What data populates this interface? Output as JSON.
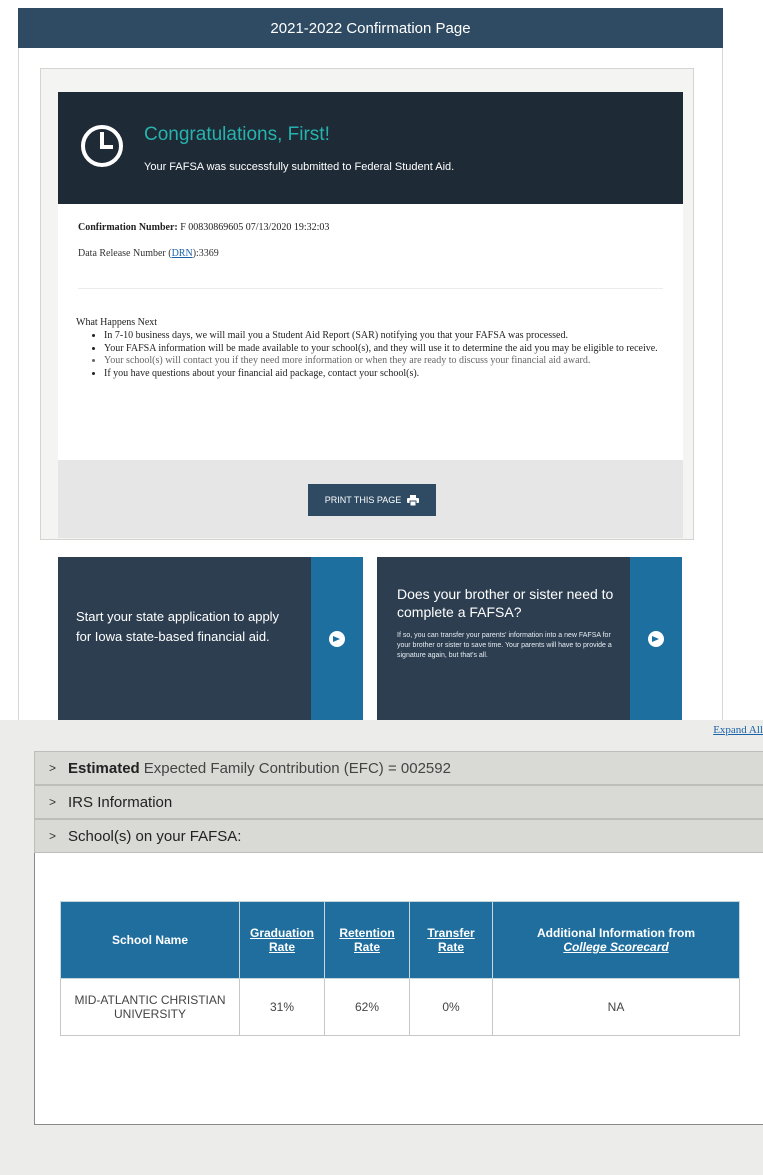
{
  "header": {
    "title": "2021-2022 Confirmation Page"
  },
  "banner": {
    "heading": "Congratulations, First!",
    "subtext": "Your FAFSA was successfully submitted to Federal Student Aid."
  },
  "confirmation": {
    "number_label": "Confirmation Number:",
    "number_value": "F 00830869605 07/13/2020 19:32:03",
    "drn_label": "Data Release Number (",
    "drn_link": "DRN",
    "drn_value": "):3369"
  },
  "next_steps": {
    "title": "What Happens Next",
    "items": [
      "In 7-10 business days, we will mail you a Student Aid Report (SAR) notifying you that your FAFSA was processed.",
      "Your FAFSA information will be made available to your school(s), and they will use it to determine the aid you may be eligible to receive.",
      "Your school(s) will contact you if they need more information or when they are ready to discuss your financial aid award.",
      "If you have questions about your financial aid package, contact your school(s)."
    ]
  },
  "print_button": {
    "label": "PRINT THIS PAGE"
  },
  "promo_left": {
    "text": "Start your state application to apply for Iowa state-based financial aid."
  },
  "promo_right": {
    "heading": "Does your brother or sister need to complete a FAFSA?",
    "subtext": "If so, you can transfer your parents' information into a new FAFSA for your brother or sister to save time. Your parents will have to provide a signature again, but that's all."
  },
  "expand_all": "Expand All",
  "accordions": {
    "efc_bold": "Estimated",
    "efc_rest": "Expected Family Contribution (EFC) = 002592",
    "irs": "IRS Information",
    "schools": "School(s) on your FAFSA:"
  },
  "school_table": {
    "headers": {
      "name": "School Name",
      "grad": "Graduation Rate",
      "retention": "Retention Rate",
      "transfer": "Transfer Rate",
      "additional_prefix": "Additional Information from",
      "additional_link": "College Scorecard"
    },
    "rows": [
      {
        "name": "MID-ATLANTIC CHRISTIAN UNIVERSITY",
        "grad": "31%",
        "retention": "62%",
        "transfer": "0%",
        "additional": "NA"
      }
    ]
  },
  "colors": {
    "header": "#2e4b63",
    "banner": "#1e2a36",
    "accent": "#27b3ad",
    "promo_strip": "#1d6fa0",
    "table_header": "#1f6e9e"
  }
}
